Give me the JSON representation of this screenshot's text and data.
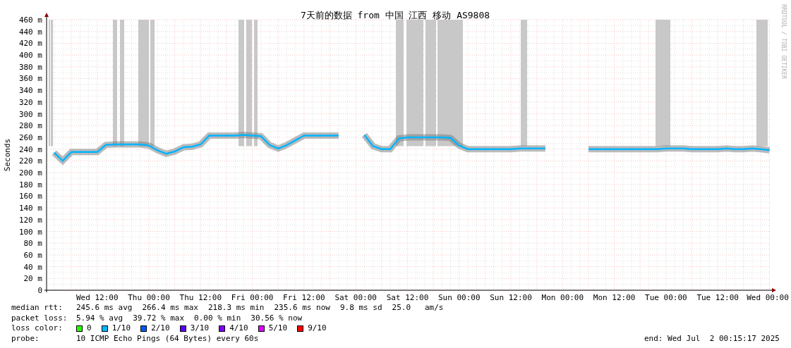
{
  "chart": {
    "chart_data": {
      "type": "line",
      "grid": true,
      "title": "7天前的数据 from 中国 江西 移动 AS9808",
      "ylabel": "Seconds",
      "ylim": [
        0,
        460
      ],
      "categories": [
        null,
        null,
        null,
        null,
        null,
        "Wed 12:00",
        null,
        null,
        null,
        null,
        null,
        "Thu 00:00",
        null,
        null,
        null,
        null,
        null,
        "Thu 12:00",
        null,
        null,
        null,
        null,
        null,
        "Fri 00:00",
        null,
        null,
        null,
        null,
        null,
        "Fri 12:00",
        null,
        null,
        null,
        null,
        null,
        "Sat 00:00",
        null,
        null,
        null,
        null,
        null,
        "Sat 12:00",
        null,
        null,
        null,
        null,
        null,
        "Sun 00:00",
        null,
        null,
        null,
        null,
        null,
        "Sun 12:00",
        null,
        null,
        null,
        null,
        null,
        "Mon 00:00",
        null,
        null,
        null,
        null,
        null,
        "Mon 12:00",
        null,
        null,
        null,
        null,
        null,
        "Tue 00:00",
        null,
        null,
        null,
        null,
        null,
        "Tue 12:00",
        null,
        null,
        null,
        null,
        null,
        "Wed 00:00"
      ],
      "yticks": [
        {
          "value": 0,
          "label": "0"
        },
        {
          "value": 20,
          "label": "20 m"
        },
        {
          "value": 40,
          "label": "40 m"
        },
        {
          "value": 60,
          "label": "60 m"
        },
        {
          "value": 80,
          "label": "80 m"
        },
        {
          "value": 100,
          "label": "100 m"
        },
        {
          "value": 120,
          "label": "120 m"
        },
        {
          "value": 140,
          "label": "140 m"
        },
        {
          "value": 160,
          "label": "160 m"
        },
        {
          "value": 180,
          "label": "180 m"
        },
        {
          "value": 200,
          "label": "200 m"
        },
        {
          "value": 220,
          "label": "220 m"
        },
        {
          "value": 240,
          "label": "240 m"
        },
        {
          "value": 260,
          "label": "260 m"
        },
        {
          "value": 280,
          "label": "280 m"
        },
        {
          "value": 300,
          "label": "300 m"
        },
        {
          "value": 320,
          "label": "320 m"
        },
        {
          "value": 340,
          "label": "340 m"
        },
        {
          "value": 360,
          "label": "360 m"
        },
        {
          "value": 380,
          "label": "380 m"
        },
        {
          "value": 400,
          "label": "400 m"
        },
        {
          "value": 420,
          "label": "420 m"
        },
        {
          "value": 440,
          "label": "440 m"
        },
        {
          "value": 460,
          "label": "460 m"
        }
      ],
      "series": [
        {
          "color": "#00b4ff",
          "values": [
            234,
            220,
            235,
            235,
            235,
            235,
            247,
            248,
            248,
            248,
            248,
            246,
            238,
            232,
            236,
            243,
            244,
            248,
            263,
            263,
            263,
            263,
            264,
            263,
            262,
            247,
            241,
            247,
            255,
            263,
            263,
            263,
            263,
            263,
            null,
            null,
            264,
            245,
            240,
            240,
            258,
            260,
            260,
            260,
            260,
            260,
            259,
            246,
            240,
            240,
            240,
            240,
            240,
            240,
            241,
            241,
            241,
            241,
            null,
            null,
            null,
            null,
            240,
            240,
            240,
            240,
            240,
            240,
            240,
            240,
            240,
            241,
            241,
            241,
            240,
            240,
            240,
            240,
            241,
            240,
            240,
            241,
            240,
            238
          ]
        }
      ]
    },
    "credit": "RRDTOOL / TOBI OETIKER"
  },
  "stats": [
    {
      "label": "median rtt:",
      "values": [
        "245.6 ms avg",
        "266.4 ms max",
        "218.3 ms min",
        "235.6 ms now",
        "9.8 ms sd",
        "25.0   am/s"
      ]
    },
    {
      "label": "packet loss:",
      "values": [
        "5.94 % avg",
        "39.72 % max",
        "0.00 % min",
        "30.56 % now"
      ]
    }
  ],
  "legend": {
    "label": "loss color:",
    "items": [
      {
        "label": "0",
        "color": "#26ff00"
      },
      {
        "label": "1/10",
        "color": "#00b8ff"
      },
      {
        "label": "2/10",
        "color": "#0059ff"
      },
      {
        "label": "3/10",
        "color": "#5e00ff"
      },
      {
        "label": "4/10",
        "color": "#7e00ff"
      },
      {
        "label": "5/10",
        "color": "#dd00ff"
      },
      {
        "label": "9/10",
        "color": "#ff0000"
      }
    ]
  },
  "probe": {
    "label": "probe:",
    "text": "10 ICMP Echo Pings (64 Bytes) every 60s"
  },
  "end": "end: Wed Jul  2 00:15:17 2025"
}
